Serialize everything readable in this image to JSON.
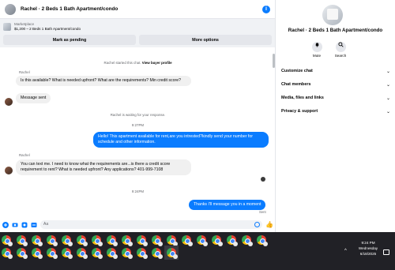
{
  "header": {
    "title": "Rachel · 2 Beds 1 Bath Apartment/condo"
  },
  "marketplace": {
    "label": "Marketplace",
    "listing": "$1,200 – 2 Beds 1 Bath Apartment/condo",
    "mark_pending": "Mark as pending",
    "more_options": "More options"
  },
  "messages": {
    "started": "Rachel started this chat.",
    "view_profile": "View buyer profile",
    "sender_name": "Rachel",
    "m1": "Is this available? What is needed upfront?  What are the requirements?  Min credit score?",
    "m2": "Message sent",
    "waiting": "Rachel is waiting for your response.",
    "time1": "9:27PM",
    "r1": "Hello! This apartment available for rent,are you intrested?kindly send your number for schedule and other information.",
    "sender_name2": "Rachel",
    "m3": "You can text me.  I need to know what the requirements are...is there a credit score requirement to rent?  What is needed upfront? Any applications? 401-999-7108",
    "time2": "9:24PM",
    "r2": "Thanks I'll message you in a moment",
    "sent_label": "Sent"
  },
  "composer": {
    "placeholder": "Aa"
  },
  "panel": {
    "title": "Rachel · 2 Beds 1 Bath Apartment/condo",
    "mute": "Mute",
    "search": "Search",
    "sections": [
      "Customize chat",
      "Chat members",
      "Media, files and links",
      "Privacy & support"
    ]
  },
  "taskbar": {
    "time": "9:24 PM",
    "day": "Wednesday",
    "date": "6/18/2025"
  },
  "icons": [
    "info-icon",
    "camera-icon",
    "sticker-icon",
    "gif-icon",
    "emoji-icon",
    "like-icon",
    "bell-icon",
    "search-icon",
    "chevron-down-icon",
    "chrome-icon"
  ],
  "colors": {
    "accent": "#0a7cff",
    "taskbar": "#212126"
  }
}
